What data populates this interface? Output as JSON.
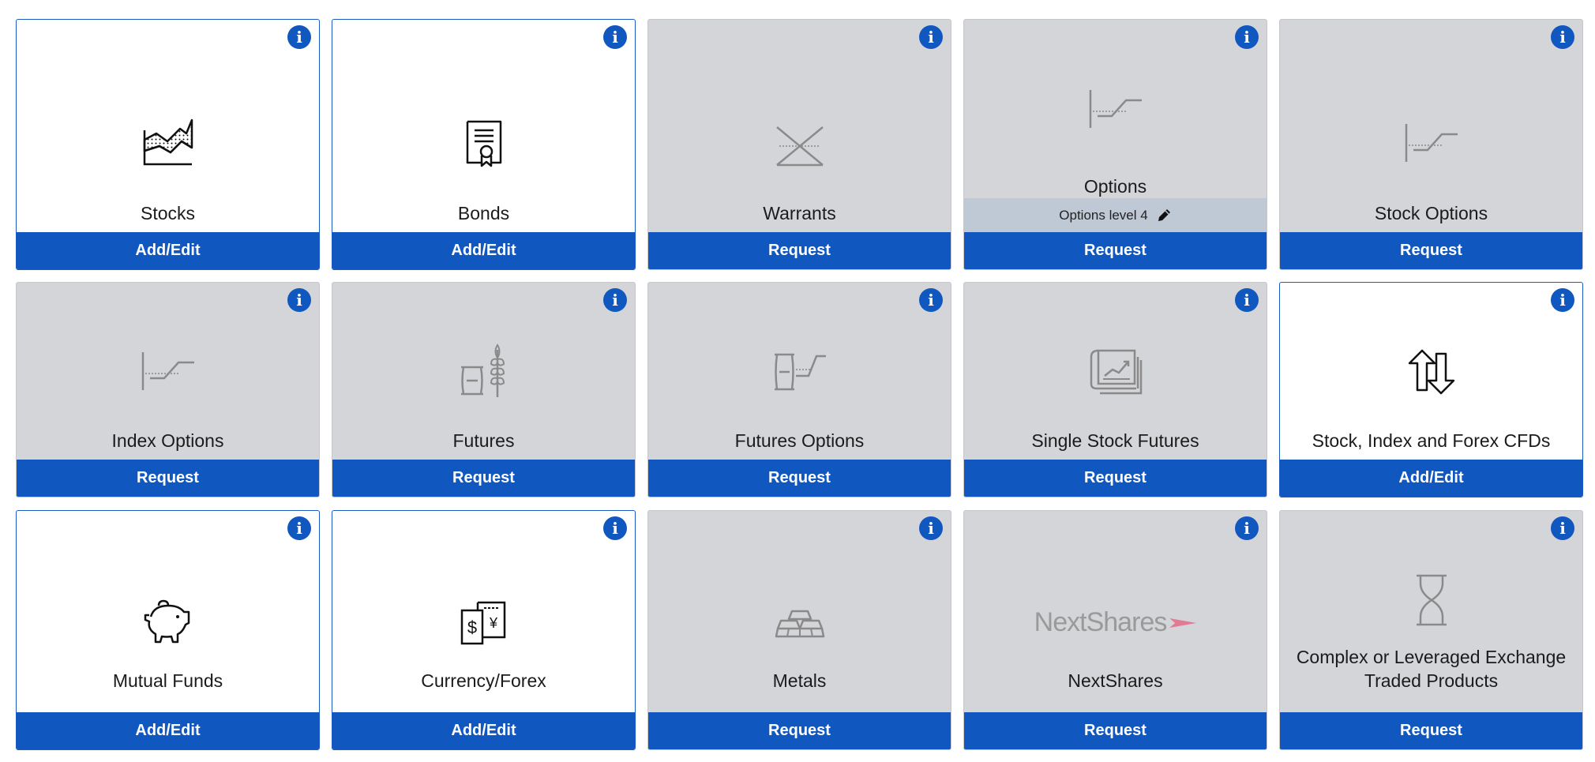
{
  "cards": [
    {
      "label": "Stocks",
      "button": "Add/Edit",
      "icon": "stock-chart-icon",
      "active": true
    },
    {
      "label": "Bonds",
      "button": "Add/Edit",
      "icon": "certificate-icon",
      "active": true
    },
    {
      "label": "Warrants",
      "button": "Request",
      "icon": "warrant-cross-icon",
      "active": false
    },
    {
      "label": "Options",
      "button": "Request",
      "icon": "option-payoff-icon",
      "active": false,
      "level_text": "Options level 4"
    },
    {
      "label": "Stock Options",
      "button": "Request",
      "icon": "option-payoff-icon",
      "active": false
    },
    {
      "label": "Index Options",
      "button": "Request",
      "icon": "option-payoff-icon",
      "active": false
    },
    {
      "label": "Futures",
      "button": "Request",
      "icon": "barrel-wheat-icon",
      "active": false
    },
    {
      "label": "Futures Options",
      "button": "Request",
      "icon": "barrel-option-icon",
      "active": false
    },
    {
      "label": "Single Stock Futures",
      "button": "Request",
      "icon": "documents-chart-icon",
      "active": false
    },
    {
      "label": "Stock, Index and Forex CFDs",
      "button": "Add/Edit",
      "icon": "exchange-arrows-icon",
      "active": true
    },
    {
      "label": "Mutual Funds",
      "button": "Add/Edit",
      "icon": "piggy-bank-icon",
      "active": true
    },
    {
      "label": "Currency/Forex",
      "button": "Add/Edit",
      "icon": "currency-notes-icon",
      "active": true
    },
    {
      "label": "Metals",
      "button": "Request",
      "icon": "gold-bars-icon",
      "active": false
    },
    {
      "label": "NextShares",
      "button": "Request",
      "icon": "nextshares-logo",
      "active": false,
      "logo_text": "NextShares"
    },
    {
      "label": "Complex or Leveraged Exchange Traded Products",
      "button": "Request",
      "icon": "hourglass-icon",
      "active": false
    }
  ],
  "info_glyph": "i",
  "colors": {
    "accent": "#1157c0",
    "inactive_bg": "#d4d5d8",
    "level_bg": "#bfc9d5"
  }
}
